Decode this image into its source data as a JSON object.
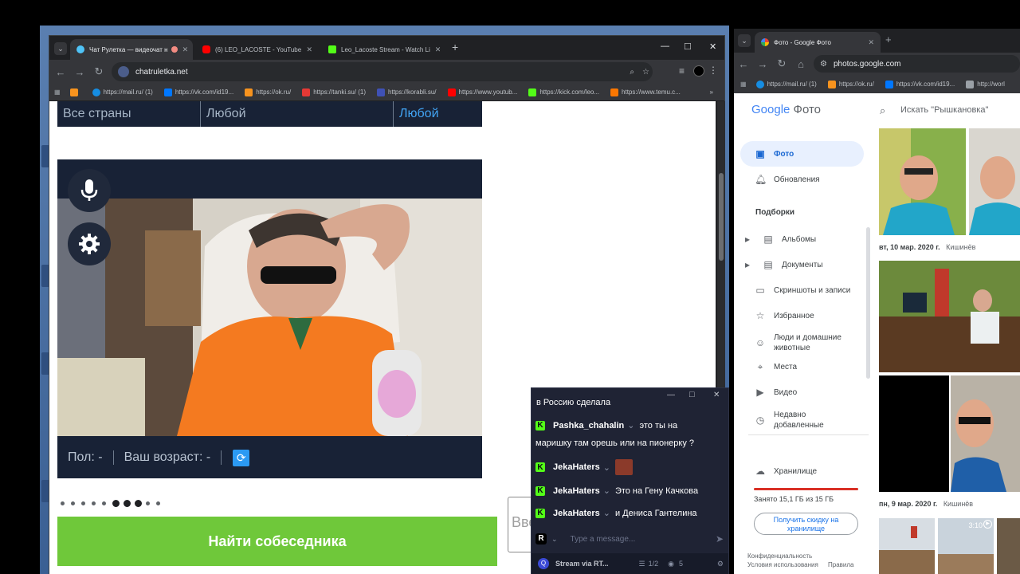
{
  "left_browser": {
    "tabs": [
      {
        "title": "Чат Рулетка — видеочат н",
        "active": true
      },
      {
        "title": "(6) LEO_LACOSTE - YouTube",
        "active": false
      },
      {
        "title": "Leo_Lacoste Stream - Watch Li",
        "active": false
      }
    ],
    "new_tab": "+",
    "url": "chatruletka.net",
    "bookmarks": [
      "https://mail.ru/ (1)",
      "https://vk.com/id19...",
      "https://ok.ru/",
      "https://tanki.su/ (1)",
      "https://korabli.su/",
      "https://www.youtub...",
      "https://kick.com/leo...",
      "https://www.temu.c..."
    ],
    "bookmarks_more": "»",
    "window_controls": {
      "minimize": "—",
      "maximize": "□",
      "close": "✕"
    }
  },
  "chatroulette": {
    "filter_country": "Все страны",
    "filter_gender": "Любой",
    "filter_gender2": "Любой",
    "info_gender": "Пол: -",
    "info_age": "Ваш возраст: -",
    "find_button": "Найти собеседника",
    "message_placeholder": "Вве",
    "dots_total": 10,
    "dots_active": 3
  },
  "right_browser": {
    "tab_title": "Фото - Google Фото",
    "url": "photos.google.com",
    "bookmarks": [
      "https://mail.ru/ (1)",
      "https://ok.ru/",
      "https://vk.com/id19...",
      "http://worl"
    ],
    "logo_google": "Google",
    "logo_photos": "Фото",
    "search_placeholder": "Искать \"Рышкановка\"",
    "nav": {
      "photos": "Фото",
      "updates": "Обновления",
      "section_collections": "Подборки",
      "albums": "Альбомы",
      "documents": "Документы",
      "screenshots": "Скриншоты и записи",
      "favorites": "Избранное",
      "people": "Люди и домашние животные",
      "places": "Места",
      "video": "Видео",
      "recent": "Недавно добавленные",
      "storage": "Хранилище"
    },
    "storage_used": "Занято 15,1 ГБ из 15 ГБ",
    "storage_fraction": 1.0,
    "discount_button": "Получить скидку на хранилище",
    "footer_privacy": "Конфиденциальность",
    "footer_terms": "Условия использования",
    "footer_rules": "Правила",
    "date1": "вт, 10 мар. 2020 г.",
    "place1": "Кишинёв",
    "date2": "пн, 9 мар. 2020 г.",
    "place2": "Кишинёв",
    "video_duration": "3:10"
  },
  "chat_popup": {
    "truncated_top": "в Россию сделала",
    "messages": [
      {
        "user": "Pashka_chahalin",
        "text": "это ты на маришку там орешь или на пионерку ?"
      },
      {
        "user": "JekaHaters",
        "text": ""
      },
      {
        "user": "JekaHaters",
        "text": "Это на Гену Качкова"
      },
      {
        "user": "JekaHaters",
        "text": "и Дениса Гантелина"
      }
    ],
    "input_placeholder": "Type a message...",
    "stream_label": "Stream via RT...",
    "pages": "1/2",
    "viewers": "5"
  },
  "colors": {
    "kick_green": "#53fc18",
    "find_green": "#6fc83a",
    "chatroulette_dark": "#182236",
    "google_blue": "#1a73e8",
    "storage_red": "#d93025"
  }
}
